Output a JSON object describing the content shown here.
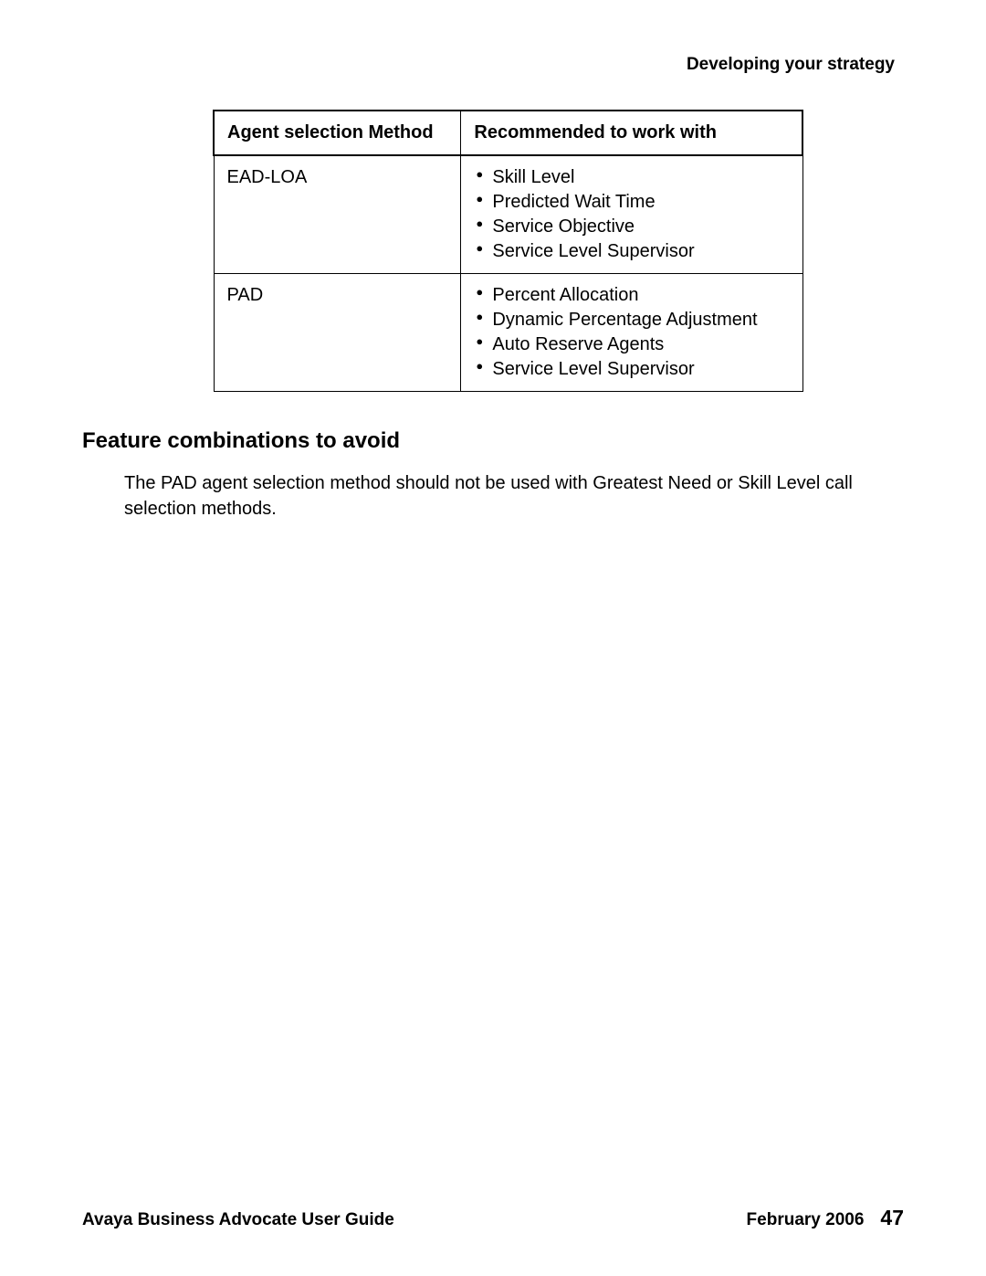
{
  "header": {
    "title": "Developing your strategy"
  },
  "table": {
    "headers": {
      "col1": "Agent selection Method",
      "col2": "Recommended to work with"
    },
    "rows": [
      {
        "method": "EAD-LOA",
        "items": [
          "Skill Level",
          "Predicted Wait Time",
          "Service Objective",
          "Service Level Supervisor"
        ]
      },
      {
        "method": "PAD",
        "items": [
          "Percent Allocation",
          "Dynamic Percentage Adjustment",
          "Auto Reserve Agents",
          "Service Level Supervisor"
        ]
      }
    ]
  },
  "section": {
    "heading": "Feature combinations to avoid",
    "body": "The PAD agent selection method should not be used with Greatest Need or Skill Level call selection methods."
  },
  "footer": {
    "left": "Avaya Business Advocate User Guide",
    "date": "February 2006",
    "page": "47"
  }
}
